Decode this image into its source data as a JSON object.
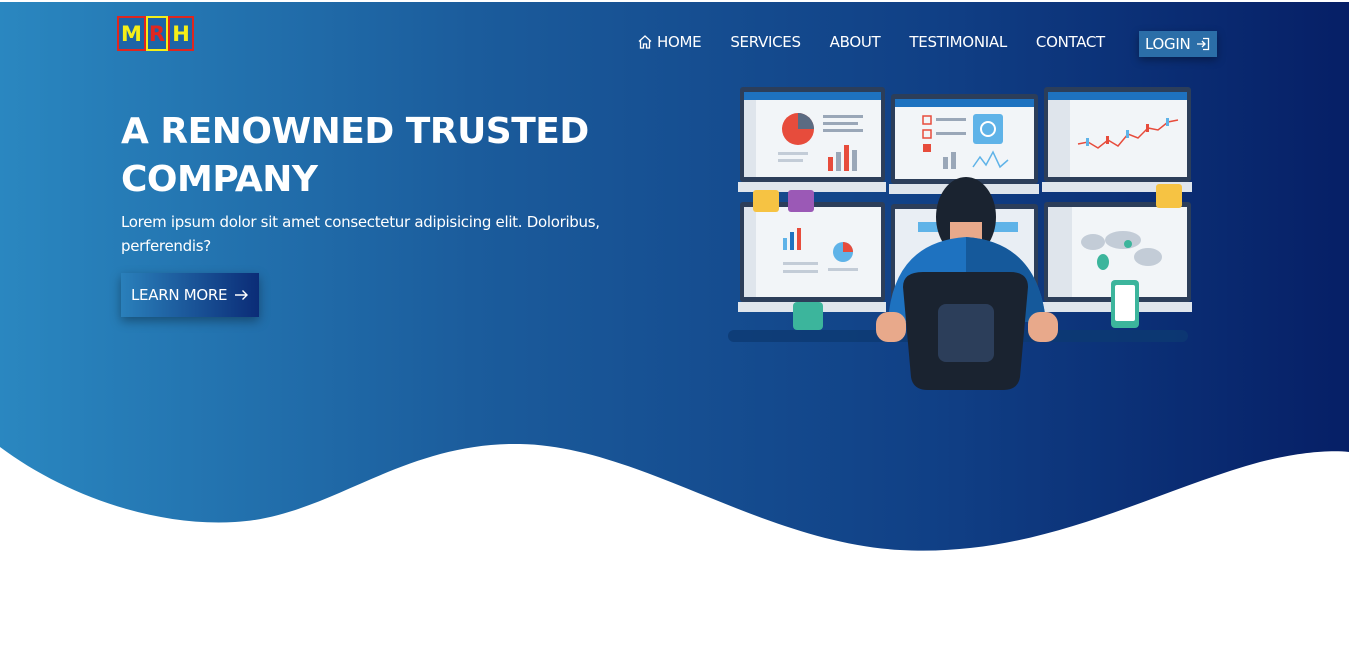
{
  "logo": {
    "letters": [
      "M",
      "R",
      "H"
    ]
  },
  "nav": {
    "items": [
      {
        "label": "HOME",
        "icon": "home-icon"
      },
      {
        "label": "SERVICES"
      },
      {
        "label": "ABOUT"
      },
      {
        "label": "TESTIMONIAL"
      },
      {
        "label": "CONTACT"
      }
    ],
    "login": {
      "label": "LOGIN",
      "icon": "sign-in-icon"
    }
  },
  "hero": {
    "title": "A RENOWNED TRUSTED COMPANY",
    "subtitle": "Lorem ipsum dolor sit amet consectetur adipisicing elit. Doloribus, perferendis?",
    "cta_label": "LEARN MORE",
    "cta_icon": "arrow-right-icon"
  },
  "colors": {
    "gradient_start": "#2a87c0",
    "gradient_end": "#061f66",
    "logo_red": "#e0261f",
    "logo_yellow": "#f4ef18"
  }
}
